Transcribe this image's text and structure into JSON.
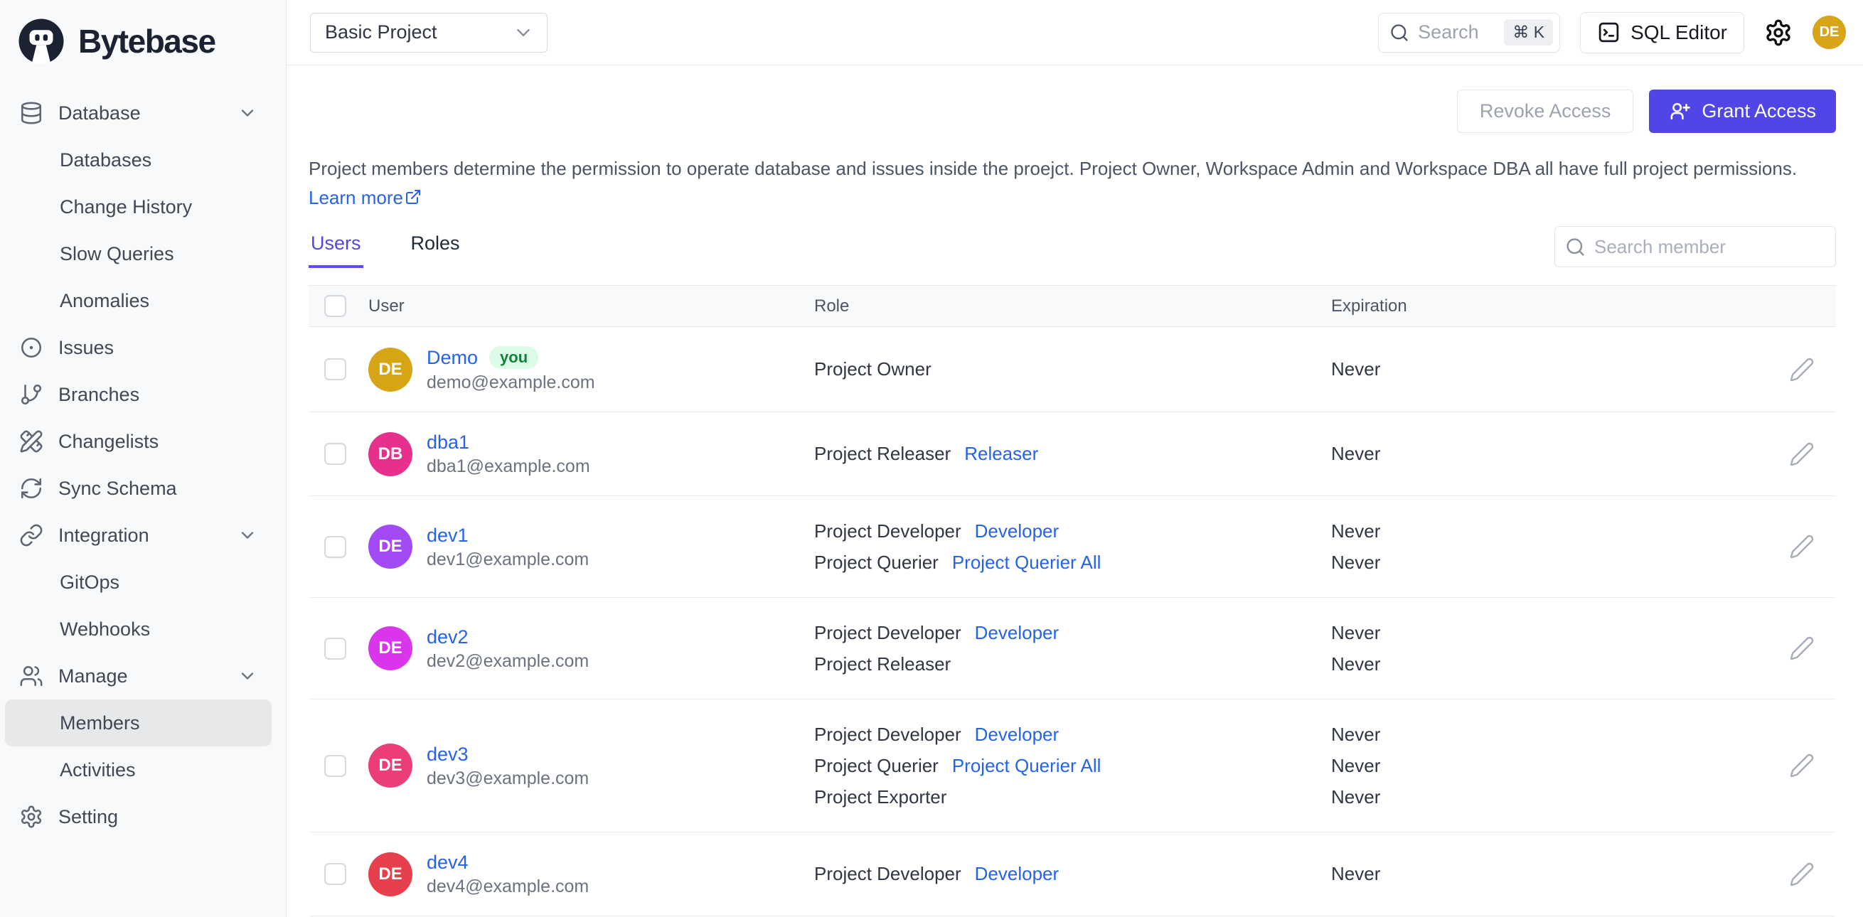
{
  "brand": {
    "name": "Bytebase"
  },
  "topbar": {
    "project_select": "Basic Project",
    "search_placeholder": "Search",
    "search_kbd": "⌘ K",
    "sql_editor_label": "SQL Editor",
    "avatar_initials": "DE",
    "avatar_color": "#d8a418"
  },
  "sidebar": {
    "items": [
      {
        "label": "Database",
        "icon": "database",
        "chevron": true,
        "level": "top"
      },
      {
        "label": "Databases",
        "level": "sub"
      },
      {
        "label": "Change History",
        "level": "sub"
      },
      {
        "label": "Slow Queries",
        "level": "sub"
      },
      {
        "label": "Anomalies",
        "level": "sub"
      },
      {
        "label": "Issues",
        "icon": "circle-dot",
        "level": "top"
      },
      {
        "label": "Branches",
        "icon": "git-branch",
        "level": "top"
      },
      {
        "label": "Changelists",
        "icon": "pencil-ruler",
        "level": "top"
      },
      {
        "label": "Sync Schema",
        "icon": "refresh",
        "level": "top"
      },
      {
        "label": "Integration",
        "icon": "link",
        "chevron": true,
        "level": "top"
      },
      {
        "label": "GitOps",
        "level": "sub"
      },
      {
        "label": "Webhooks",
        "level": "sub"
      },
      {
        "label": "Manage",
        "icon": "users",
        "chevron": true,
        "level": "top"
      },
      {
        "label": "Members",
        "level": "sub",
        "active": true
      },
      {
        "label": "Activities",
        "level": "sub"
      },
      {
        "label": "Setting",
        "icon": "gear",
        "level": "top"
      }
    ]
  },
  "actions": {
    "revoke_label": "Revoke Access",
    "grant_label": "Grant Access",
    "grant_color": "#4f46e5"
  },
  "description": {
    "text": "Project members determine the permission to operate database and issues inside the proejct. Project Owner, Workspace Admin and Workspace DBA all have full project permissions.",
    "learn_more_label": "Learn more"
  },
  "tabs": [
    {
      "label": "Users",
      "active": true
    },
    {
      "label": "Roles",
      "active": false
    }
  ],
  "member_search": {
    "placeholder": "Search member"
  },
  "table": {
    "headers": {
      "user": "User",
      "role": "Role",
      "expiration": "Expiration"
    },
    "you_badge": "you",
    "rows": [
      {
        "initials": "DE",
        "avatar_color": "#d6a516",
        "name": "Demo",
        "you": true,
        "email": "demo@example.com",
        "roles": [
          {
            "role": "Project Owner",
            "link": "",
            "expiration": "Never"
          }
        ]
      },
      {
        "initials": "DB",
        "avatar_color": "#e7308c",
        "name": "dba1",
        "you": false,
        "email": "dba1@example.com",
        "roles": [
          {
            "role": "Project Releaser",
            "link": "Releaser",
            "expiration": "Never"
          }
        ]
      },
      {
        "initials": "DE",
        "avatar_color": "#a24bf5",
        "name": "dev1",
        "you": false,
        "email": "dev1@example.com",
        "roles": [
          {
            "role": "Project Developer",
            "link": "Developer",
            "expiration": "Never"
          },
          {
            "role": "Project Querier",
            "link": "Project Querier All",
            "expiration": "Never"
          }
        ]
      },
      {
        "initials": "DE",
        "avatar_color": "#d936ec",
        "name": "dev2",
        "you": false,
        "email": "dev2@example.com",
        "roles": [
          {
            "role": "Project Developer",
            "link": "Developer",
            "expiration": "Never"
          },
          {
            "role": "Project Releaser",
            "link": "",
            "expiration": "Never"
          }
        ]
      },
      {
        "initials": "DE",
        "avatar_color": "#eb3d77",
        "name": "dev3",
        "you": false,
        "email": "dev3@example.com",
        "roles": [
          {
            "role": "Project Developer",
            "link": "Developer",
            "expiration": "Never"
          },
          {
            "role": "Project Querier",
            "link": "Project Querier All",
            "expiration": "Never"
          },
          {
            "role": "Project Exporter",
            "link": "",
            "expiration": "Never"
          }
        ]
      },
      {
        "initials": "DE",
        "avatar_color": "#e5404b",
        "name": "dev4",
        "you": false,
        "email": "dev4@example.com",
        "roles": [
          {
            "role": "Project Developer",
            "link": "Developer",
            "expiration": "Never"
          }
        ]
      }
    ]
  }
}
